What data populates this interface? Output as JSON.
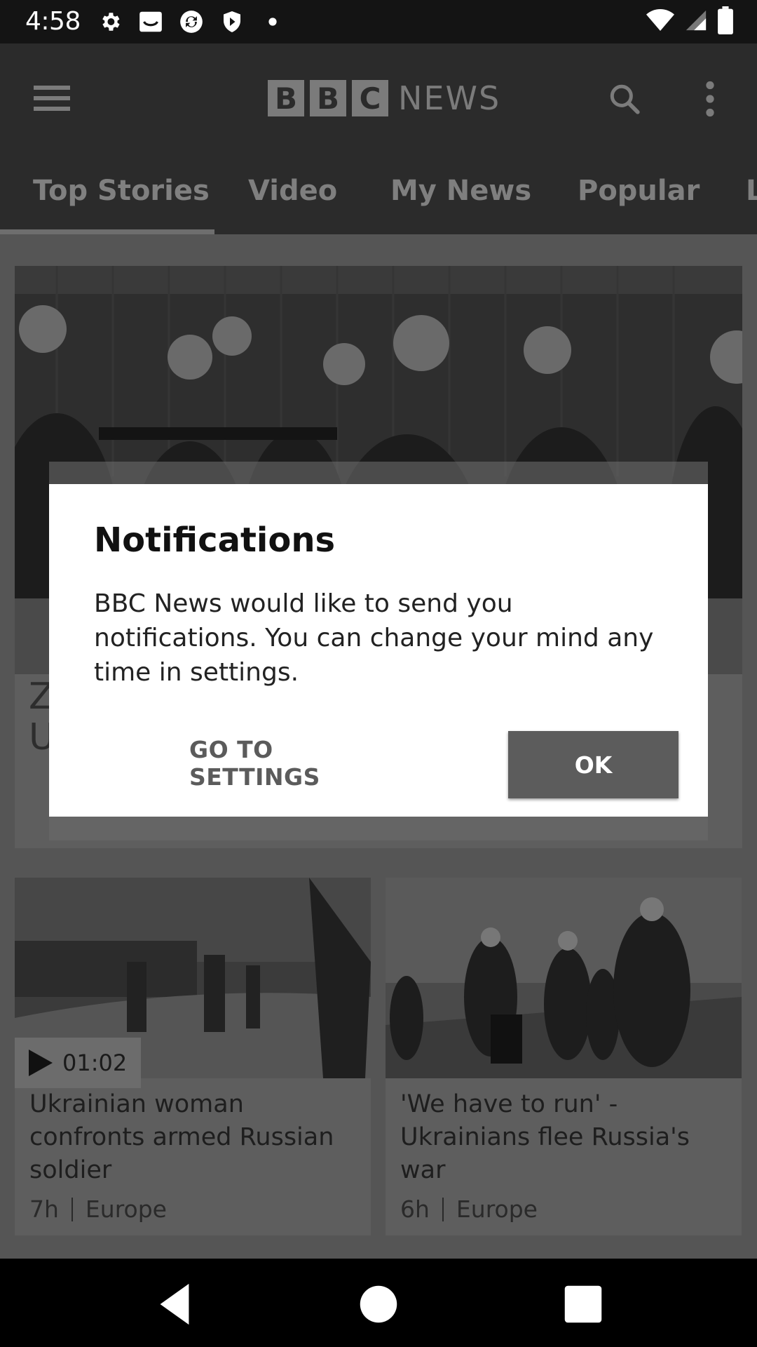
{
  "status_bar": {
    "time": "4:58",
    "icons_left": [
      "settings-icon",
      "inbox-icon",
      "sync-icon",
      "shield-play-icon",
      "dot-icon"
    ],
    "icons_right": [
      "wifi-icon",
      "signal-icon",
      "battery-icon"
    ]
  },
  "app_bar": {
    "logo_letters": [
      "B",
      "B",
      "C"
    ],
    "logo_word": "NEWS",
    "menu_icon": "hamburger-icon",
    "search_icon": "search-icon",
    "more_icon": "more-vert-icon"
  },
  "tabs": [
    {
      "label": "Top Stories",
      "selected": true
    },
    {
      "label": "Video"
    },
    {
      "label": "My News"
    },
    {
      "label": "Popular"
    },
    {
      "label": "L"
    }
  ],
  "content": {
    "top_story_partial": "Z\nU",
    "cards": [
      {
        "title": "Ukrainian woman confronts armed Russian soldier",
        "time": "7h",
        "section": "Europe",
        "duration": "01:02"
      },
      {
        "title": "'We have to run' - Ukrainians flee Russia's war",
        "time": "6h",
        "section": "Europe"
      }
    ]
  },
  "dialog": {
    "title": "Notifications",
    "body": "BBC News would like to send you notifications. You can change your mind any time in settings.",
    "secondary_button": "GO TO SETTINGS",
    "primary_button": "OK"
  },
  "nav_bar": {
    "icons": [
      "back-icon",
      "home-icon",
      "recents-icon"
    ]
  },
  "colors": {
    "dialog_bg": "#ffffff",
    "ok_button": "#5c5c5c",
    "app_bar": "#2b2b2b"
  }
}
